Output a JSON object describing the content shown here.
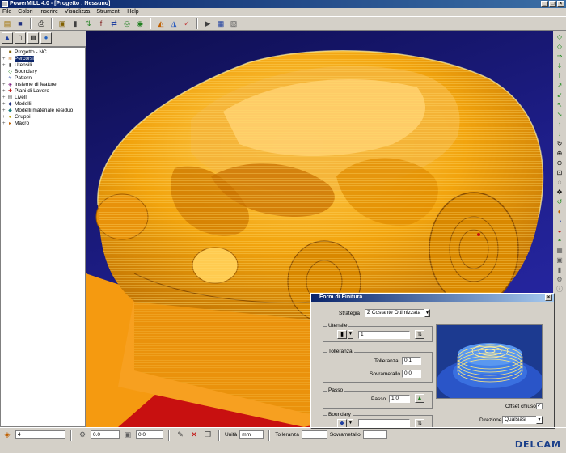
{
  "window": {
    "title": "PowerMILL 4.0 - [Progetto : Nessuno]"
  },
  "menu": [
    "File",
    "Colori",
    "Inserire",
    "Visualizza",
    "Strumenti",
    "Help"
  ],
  "tree": [
    {
      "label": "Progetto - NC",
      "icon": "project-icon",
      "exp": ""
    },
    {
      "label": "Percorsi",
      "icon": "toolpath-icon",
      "exp": "+",
      "selected": true
    },
    {
      "label": "Utensili",
      "icon": "tool-icon",
      "exp": "+"
    },
    {
      "label": "Boundary",
      "icon": "boundary-icon",
      "exp": ""
    },
    {
      "label": "Pattern",
      "icon": "pattern-icon",
      "exp": ""
    },
    {
      "label": "Insieme di feature",
      "icon": "feature-icon",
      "exp": "+"
    },
    {
      "label": "Piani di Lavoro",
      "icon": "workplane-icon",
      "exp": "+"
    },
    {
      "label": "Livelli",
      "icon": "level-icon",
      "exp": "+"
    },
    {
      "label": "Modelli",
      "icon": "model-icon",
      "exp": "+"
    },
    {
      "label": "Modelli materiale residuo",
      "icon": "stock-model-icon",
      "exp": "+"
    },
    {
      "label": "Gruppi",
      "icon": "group-icon",
      "exp": "+"
    },
    {
      "label": "Macro",
      "icon": "macro-icon",
      "exp": "+"
    }
  ],
  "dialog": {
    "title": "Form di Finitura",
    "strategy_label": "Strategia",
    "strategy_value": "Z Costante Ottimizzata",
    "tool_group": "Utensile",
    "tool_value": "1",
    "tolerance_group": "Tolleranza",
    "tolerance_label": "Tolleranza",
    "tolerance_value": "0.1",
    "stock_label": "Sovrametallo",
    "stock_value": "0.0",
    "step_group": "Passo",
    "step_label": "Passo",
    "step_value": "1.0",
    "boundary_group": "Boundary",
    "offset_label": "Offset chiuso",
    "direction_label": "Direzione",
    "direction_value": "Qualsiasi"
  },
  "status": {
    "field1": "4",
    "field2": "0.0",
    "field3": "0.0",
    "unit_label": "Unità",
    "unit_value": "mm",
    "tolerance_label": "Tolleranza",
    "stock_label": "Sovrametallo"
  },
  "brand": "DELCAM",
  "colors": {
    "accent": "#0a246a",
    "model": "#f2a40e",
    "background": "#1e1e8a"
  }
}
